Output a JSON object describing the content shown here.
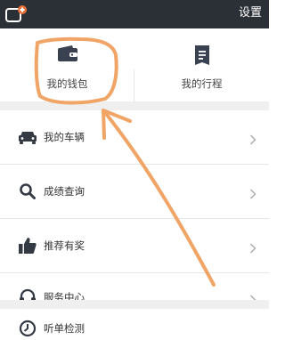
{
  "header": {
    "settings_label": "设置"
  },
  "quick_actions": {
    "wallet_label": "我的钱包",
    "trips_label": "我的行程"
  },
  "menu": {
    "items": [
      {
        "label": "我的车辆",
        "icon": "car-icon"
      },
      {
        "label": "成绩查询",
        "icon": "search-icon"
      },
      {
        "label": "推荐有奖",
        "icon": "thumbs-up-icon"
      },
      {
        "label": "服务中心",
        "icon": "headset-icon"
      }
    ],
    "extra": {
      "label": "听单检测",
      "icon": "clock-icon"
    }
  },
  "colors": {
    "header_bg": "#2b2f36",
    "badge": "#e8703a",
    "annotation": "#f0a466",
    "divider": "#efefef"
  }
}
